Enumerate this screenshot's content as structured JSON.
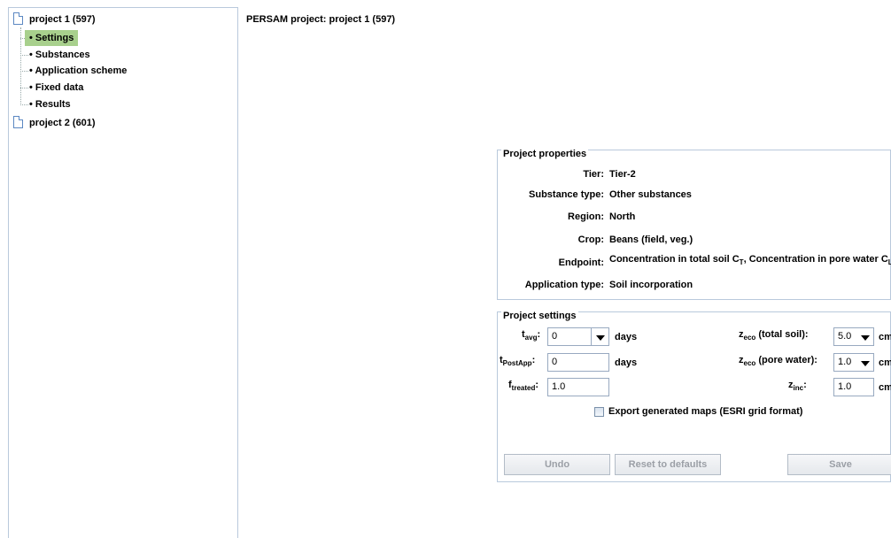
{
  "tree": {
    "project1": "project 1 (597)",
    "children": [
      "Settings",
      "Substances",
      "Application scheme",
      "Fixed data",
      "Results"
    ],
    "project2": "project 2 (601)"
  },
  "header": {
    "title": "PERSAM project: project 1 (597)"
  },
  "properties": {
    "title": "Project properties",
    "tier_label": "Tier:",
    "tier_value": "Tier-2",
    "substance_label": "Substance type:",
    "substance_value": "Other substances",
    "region_label": "Region:",
    "region_value": "North",
    "crop_label": "Crop:",
    "crop_value": "Beans (field, veg.)",
    "endpoint_label": "Endpoint:",
    "endpoint_a": "Concentration in total soil C",
    "endpoint_a_sub": "T",
    "endpoint_sep": ", ",
    "endpoint_b": "Concentration in pore water C",
    "endpoint_b_sub": "L",
    "apptype_label": "Application type:",
    "apptype_value": "Soil incorporation"
  },
  "settings": {
    "title": "Project settings",
    "tavg_sym": "t",
    "tavg_sub": "avg",
    "tavg_value": "0",
    "tpost_sym": "t",
    "tpost_sub": "PostApp",
    "tpost_value": "0",
    "ftreated_sym": "f",
    "ftreated_sub": "treated",
    "ftreated_value": "1.0",
    "days": "days",
    "zeco_sym": "z",
    "zeco_sub": "eco",
    "zeco_total_suffix": " (total soil):",
    "zeco_total_value": "5.0",
    "zeco_pore_suffix": " (pore water):",
    "zeco_pore_value": "1.0",
    "zinc_sym": "z",
    "zinc_sub": "inc",
    "zinc_value": "1.0",
    "unit": "cm",
    "export_label": "Export generated maps (ESRI grid format)",
    "undo": "Undo",
    "reset": "Reset to defaults",
    "save": "Save"
  }
}
